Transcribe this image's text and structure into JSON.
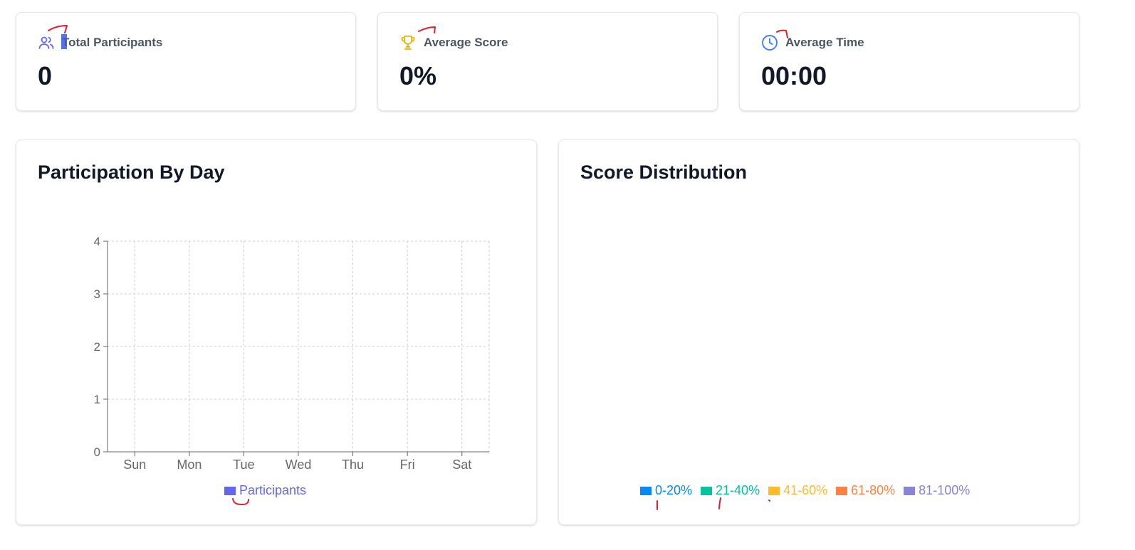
{
  "stats": {
    "participants": {
      "label": "Total Participants",
      "value": "0",
      "icon": "users-icon",
      "color": "#6366f1"
    },
    "score": {
      "label": "Average Score",
      "value": "0%",
      "icon": "trophy-icon",
      "color": "#eab308"
    },
    "time": {
      "label": "Average Time",
      "value": "00:00",
      "icon": "clock-icon",
      "color": "#3b82f6"
    }
  },
  "participation": {
    "title": "Participation By Day",
    "legend_label": "Participants",
    "legend_color": "#6366f1"
  },
  "distribution": {
    "title": "Score Distribution",
    "legend": [
      {
        "label": "0-20%",
        "color": "#0088fe"
      },
      {
        "label": "21-40%",
        "color": "#00c49f"
      },
      {
        "label": "41-60%",
        "color": "#ffbb28"
      },
      {
        "label": "61-80%",
        "color": "#ff8042"
      },
      {
        "label": "81-100%",
        "color": "#8884d8"
      }
    ]
  },
  "chart_data": [
    {
      "type": "bar",
      "categories": [
        "Sun",
        "Mon",
        "Tue",
        "Wed",
        "Thu",
        "Fri",
        "Sat"
      ],
      "series": [
        {
          "name": "Participants",
          "values": [
            0,
            0,
            0,
            0,
            0,
            0,
            0
          ]
        }
      ],
      "yticks": [
        "0",
        "1",
        "2",
        "3",
        "4"
      ],
      "ylim": [
        0,
        4
      ],
      "grid": true,
      "legend_position": "bottom"
    },
    {
      "type": "pie",
      "categories": [
        "0-20%",
        "21-40%",
        "41-60%",
        "61-80%",
        "81-100%"
      ],
      "values": [
        0,
        0,
        0,
        0,
        0
      ],
      "legend_position": "bottom"
    }
  ]
}
